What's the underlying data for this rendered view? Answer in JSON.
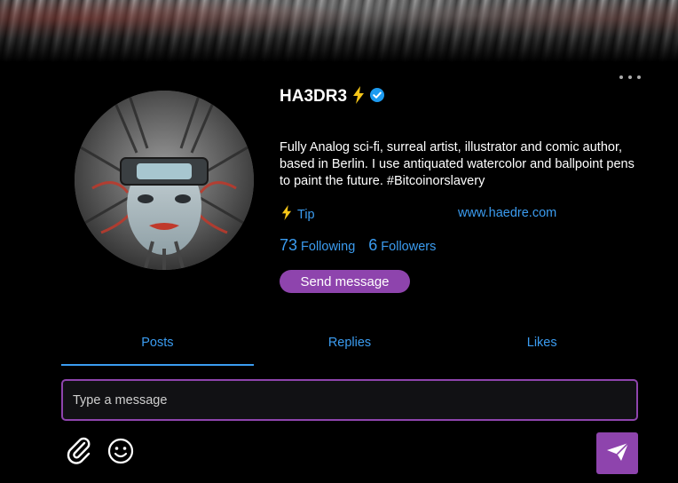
{
  "profile": {
    "name": "HA3DR3",
    "bio": "Fully Analog sci-fi, surreal artist, illustrator and comic author, based in Berlin. I use antiquated watercolor and ballpoint pens to paint the future. #Bitcoinorslavery",
    "tip_label": "Tip",
    "website": "www.haedre.com",
    "following_count": "73",
    "following_label": "Following",
    "followers_count": "6",
    "followers_label": "Followers",
    "send_message_label": "Send message"
  },
  "tabs": [
    {
      "label": "Posts",
      "active": true
    },
    {
      "label": "Replies",
      "active": false
    },
    {
      "label": "Likes",
      "active": false
    }
  ],
  "composer": {
    "placeholder": "Type a message"
  },
  "icons": {
    "more": "more-horizontal-icon",
    "lightning": "lightning-icon",
    "verified": "verified-badge-icon",
    "attach": "paperclip-icon",
    "emoji": "smiley-icon",
    "send": "paper-plane-icon"
  },
  "colors": {
    "accent_purple": "#8e44ad",
    "link_blue": "#3b9cf0",
    "lightning_yellow": "#f5c518",
    "verified_blue": "#1d9bf0",
    "background": "#000000"
  }
}
